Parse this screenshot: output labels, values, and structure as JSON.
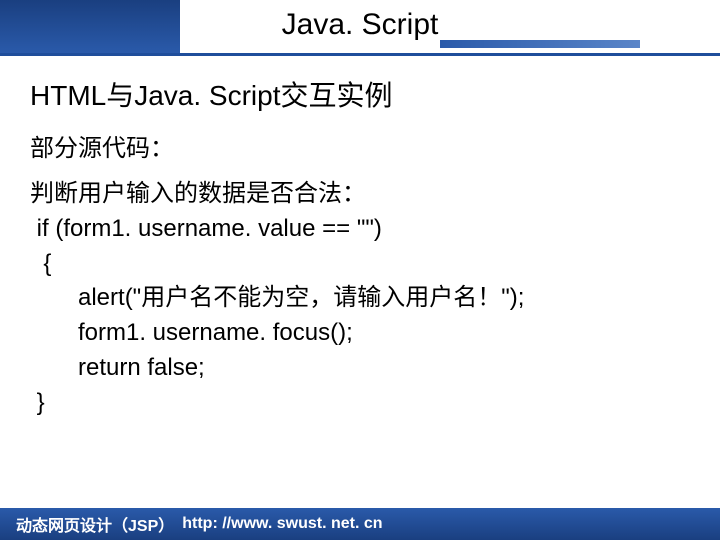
{
  "slide": {
    "title": "Java. Script"
  },
  "content": {
    "section_title": "HTML与Java. Script交互实例",
    "subheading": "部分源代码：",
    "code_intro": "判断用户输入的数据是否合法：",
    "code_lines": {
      "l1": " if (form1. username. value == \"\")",
      "l2": "  {",
      "l3": "alert(\"用户名不能为空，请输入用户名！\");",
      "l4": "form1. username. focus();",
      "l5": "return false;",
      "l6": " }"
    }
  },
  "footer": {
    "label": "动态网页设计（JSP）",
    "url": "http: //www. swust. net. cn"
  }
}
